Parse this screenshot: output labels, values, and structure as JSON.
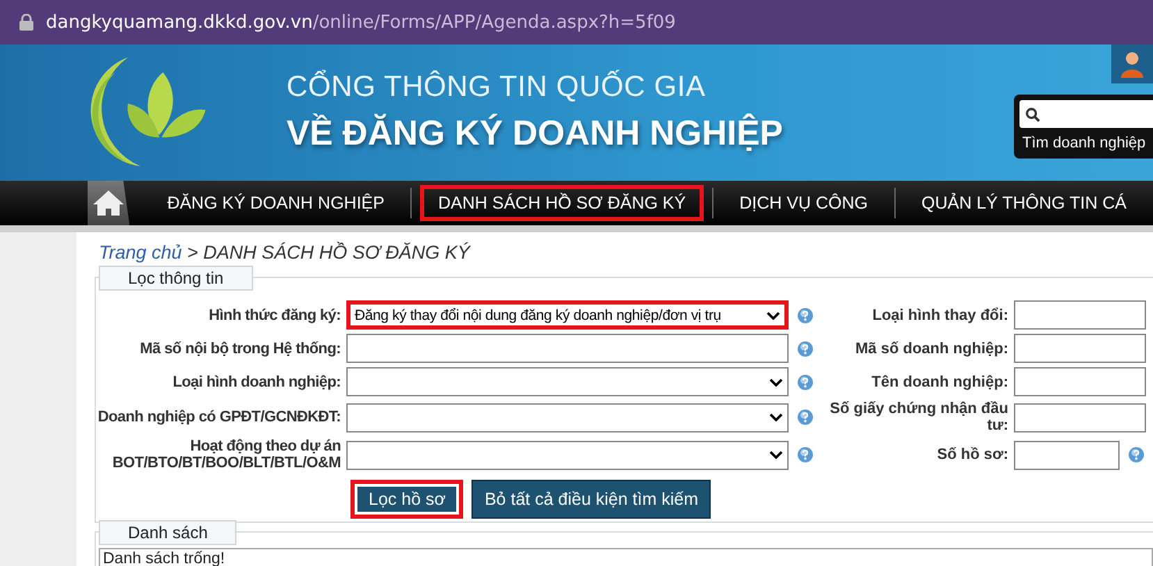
{
  "address_bar": {
    "domain": "dangkyquamang.dkkd.gov.vn",
    "path": "/online/Forms/APP/Agenda.aspx?h=5f09"
  },
  "header": {
    "title_line_1": "CỔNG THÔNG TIN QUỐC GIA",
    "title_line_2": "VỀ ĐĂNG KÝ DOANH NGHIỆP",
    "search": {
      "button": "Tìm doanh nghiệp"
    }
  },
  "nav": [
    {
      "label": "ĐĂNG KÝ DOANH NGHIỆP",
      "highlighted": false
    },
    {
      "label": "DANH SÁCH HỒ SƠ ĐĂNG KÝ",
      "highlighted": true
    },
    {
      "label": "DỊCH VỤ CÔNG",
      "highlighted": false
    },
    {
      "label": "QUẢN LÝ THÔNG TIN CÁ",
      "highlighted": false
    }
  ],
  "breadcrumb": {
    "link": "Trang chủ",
    "current": " > DANH SÁCH HỒ SƠ ĐĂNG KÝ"
  },
  "filter": {
    "legend": "Lọc thông tin",
    "left_fields": [
      {
        "label": "Hình thức đăng ký:",
        "kind": "select",
        "value": "Đăng ký thay đổi nội dung đăng ký doanh nghiệp/đơn vị trụ",
        "highlighted": true
      },
      {
        "label": "Mã số nội bộ trong Hệ thống:",
        "kind": "text",
        "highlighted": false
      },
      {
        "label": "Loại hình doanh nghiệp:",
        "kind": "select",
        "highlighted": false
      },
      {
        "label": "Doanh nghiệp có GPĐT/GCNĐKĐT:",
        "kind": "select",
        "highlighted": false
      },
      {
        "label": "Hoạt động theo dự án BOT/BTO/BT/BOO/BLT/BTL/O&M",
        "kind": "select",
        "highlighted": false
      }
    ],
    "right_fields": [
      {
        "label": "Loại hình thay đổi:",
        "kind": "text"
      },
      {
        "label": "Mã số doanh nghiệp:",
        "kind": "text"
      },
      {
        "label": "Tên doanh nghiệp:",
        "kind": "text"
      },
      {
        "label": "Số giấy chứng nhận đầu tư:",
        "kind": "text"
      },
      {
        "label": "Số hồ sơ:",
        "kind": "short_with_help"
      }
    ],
    "buttons": [
      {
        "label": "Lọc hồ sơ",
        "highlighted": true
      },
      {
        "label": "Bỏ tất cả điều kiện tìm kiếm",
        "highlighted": false
      }
    ]
  },
  "list": {
    "legend": "Danh sách",
    "message": "Danh sách trống!"
  }
}
